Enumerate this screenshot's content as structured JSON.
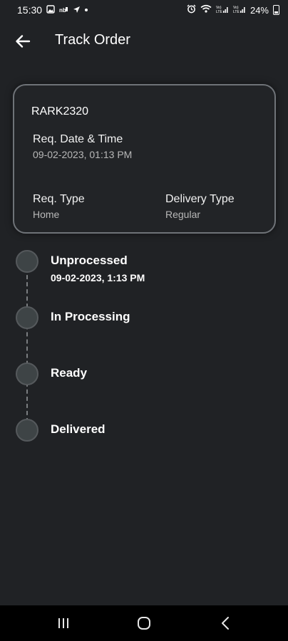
{
  "status_bar": {
    "time": "15:30",
    "battery": "24%",
    "icons": [
      "image-icon",
      "nfc-icon",
      "navigation-icon",
      "dot-icon",
      "alarm-icon",
      "wifi-icon",
      "signal-icon",
      "signal-icon",
      "battery-icon"
    ]
  },
  "header": {
    "title": "Track Order",
    "back_icon": "arrow-left-icon"
  },
  "order": {
    "id": "RARK2320",
    "req_datetime_label": "Req. Date & Time",
    "req_datetime_value": "09-02-2023,  01:13 PM",
    "req_type_label": "Req. Type",
    "req_type_value": "Home",
    "delivery_type_label": "Delivery Type",
    "delivery_type_value": "Regular"
  },
  "timeline": {
    "steps": [
      {
        "label": "Unprocessed",
        "date": "09-02-2023, 1:13 PM"
      },
      {
        "label": "In Processing"
      },
      {
        "label": "Ready"
      },
      {
        "label": "Delivered"
      }
    ]
  },
  "nav": {
    "icons": [
      "recent-apps-icon",
      "home-icon",
      "back-icon"
    ]
  },
  "colors": {
    "background": "#202225",
    "card_border": "#6f7378",
    "node_fill": "#3e4446",
    "nav_bar": "#000000"
  }
}
